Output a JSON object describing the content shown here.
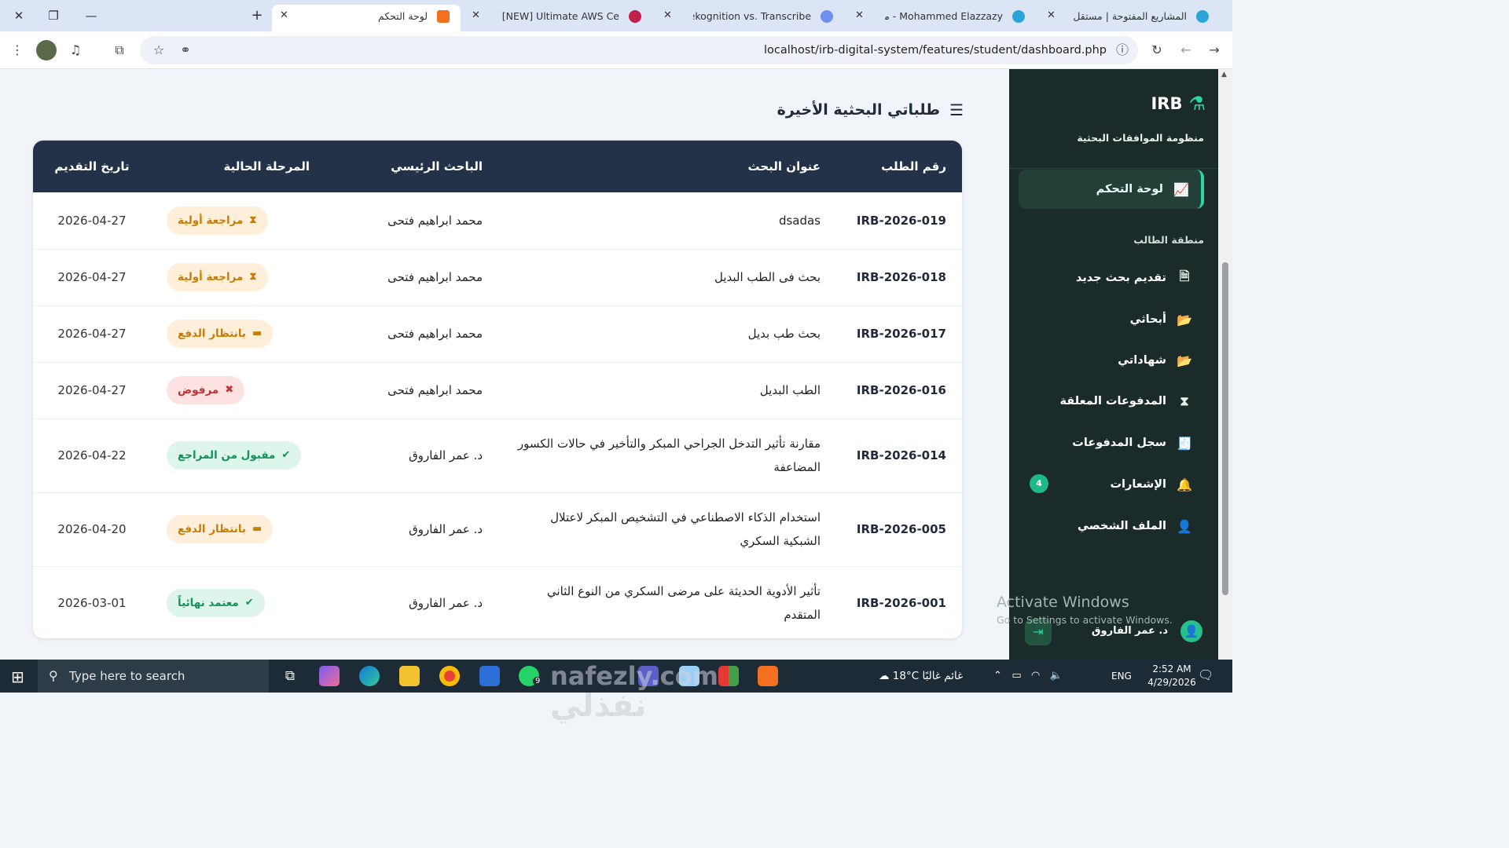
{
  "browser": {
    "tabs": [
      {
        "title": "لوحة التحكم",
        "active": true
      },
      {
        "title": "Course: [NEW] Ultimate AWS Ce"
      },
      {
        "title": "AWS Rekognition vs. Transcribe"
      },
      {
        "title": "Mohammed Elazzazy - مستقل |"
      },
      {
        "title": "المشاريع المفتوحة | مستقل"
      }
    ],
    "new_tab": "+",
    "url": "localhost/irb-digital-system/features/student/dashboard.php"
  },
  "sidebar": {
    "brand": "IRB",
    "subtitle": "منظومة الموافقات البحثية",
    "active_item": "لوحة التحكم",
    "group_label": "منطقة الطالب",
    "items": [
      {
        "label": "تقديم بحث جديد",
        "icon": "file-plus-icon"
      },
      {
        "label": "أبحاثي",
        "icon": "folder-open-icon"
      },
      {
        "label": "شهاداتي",
        "icon": "folder-open-icon"
      },
      {
        "label": "المدفوعات المعلقة",
        "icon": "hourglass-icon"
      },
      {
        "label": "سجل المدفوعات",
        "icon": "receipt-icon"
      },
      {
        "label": "الإشعارات",
        "icon": "bell-icon"
      },
      {
        "label": "الملف الشخصي",
        "icon": "user-icon"
      }
    ],
    "notifications_count": "4",
    "user_name": "د. عمر الفاروق"
  },
  "main": {
    "section_title": "طلباتي البحثية الأخيرة",
    "table": {
      "headers": [
        "رقم الطلب",
        "عنوان البحث",
        "الباحث الرئيسي",
        "المرحلة الحالية",
        "تاريخ التقديم"
      ],
      "rows": [
        {
          "id": "IRB-2026-019",
          "title": "dsadas",
          "researcher": "محمد ابراهيم فتحى",
          "stage": "مراجعة أولية",
          "status": "review",
          "date": "2026-04-27"
        },
        {
          "id": "IRB-2026-018",
          "title": "بحث فى الطب البديل",
          "researcher": "محمد ابراهيم فتحى",
          "stage": "مراجعة أولية",
          "status": "review",
          "date": "2026-04-27"
        },
        {
          "id": "IRB-2026-017",
          "title": "بحث طب بديل",
          "researcher": "محمد ابراهيم فتحى",
          "stage": "بانتظار الدفع",
          "status": "pay",
          "date": "2026-04-27"
        },
        {
          "id": "IRB-2026-016",
          "title": "الطب البديل",
          "researcher": "محمد ابراهيم فتحى",
          "stage": "مرفوض",
          "status": "reject",
          "date": "2026-04-27"
        },
        {
          "id": "IRB-2026-014",
          "title": "مقارنة تأثير التدخل الجراحي المبكر والتأخير في حالات الكسور المضاعفة",
          "researcher": "د. عمر الفاروق",
          "stage": "مقبول من المراجع",
          "status": "accept",
          "date": "2026-04-22"
        },
        {
          "id": "IRB-2026-005",
          "title": "استخدام الذكاء الاصطناعي في التشخيص المبكر لاعتلال الشبكية السكري",
          "researcher": "د. عمر الفاروق",
          "stage": "بانتظار الدفع",
          "status": "pay",
          "date": "2026-04-20"
        },
        {
          "id": "IRB-2026-001",
          "title": "تأثير الأدوية الحديثة على مرضى السكري من النوع الثاني المتقدم",
          "researcher": "د. عمر الفاروق",
          "stage": "معتمد نهائياً",
          "status": "final",
          "date": "2026-03-01"
        }
      ]
    }
  },
  "windows": {
    "activate_title": "Activate Windows",
    "activate_sub": "Go to Settings to activate Windows."
  },
  "taskbar": {
    "search_placeholder": "Type here to search",
    "weather": "18°C  غائم غالبًا",
    "language": "ENG",
    "time": "2:52 AM",
    "date": "4/29/2026",
    "whatsapp_count": "9"
  },
  "overlay": {
    "site_watermark": "nafezly.com",
    "site_watermark_ar": "نفذلي"
  },
  "colors": {
    "table_header": "#233248",
    "sidebar_bg": "#1a2b2a",
    "accent": "#2dd4a4",
    "warning": "#c77d08",
    "danger": "#c53030",
    "success": "#17915b"
  }
}
